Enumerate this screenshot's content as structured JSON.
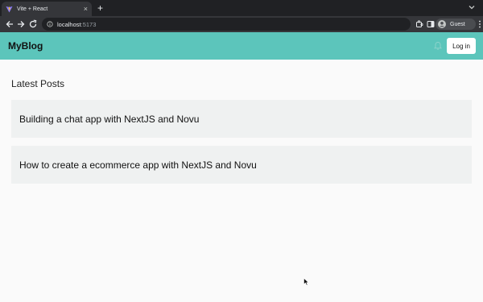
{
  "browser": {
    "tab_title": "Vite + React",
    "tab_close": "×",
    "new_tab": "+",
    "url_host": "localhost",
    "url_port": ":5173",
    "profile_label": "Guest"
  },
  "app": {
    "brand": "MyBlog",
    "login_label": "Log in",
    "header_color": "#5cc5bb"
  },
  "main": {
    "section_title": "Latest Posts",
    "posts": [
      {
        "title": "Building a chat app with NextJS and Novu"
      },
      {
        "title": "How to create a ecommerce app with NextJS and Novu"
      }
    ]
  },
  "icons": [
    "vite-favicon-icon",
    "close-icon",
    "plus-icon",
    "chevron-down-icon",
    "back-arrow-icon",
    "forward-arrow-icon",
    "reload-icon",
    "info-icon",
    "extensions-icon",
    "sidebar-icon",
    "avatar-icon",
    "kebab-menu-icon",
    "bell-icon",
    "mouse-cursor-icon"
  ]
}
